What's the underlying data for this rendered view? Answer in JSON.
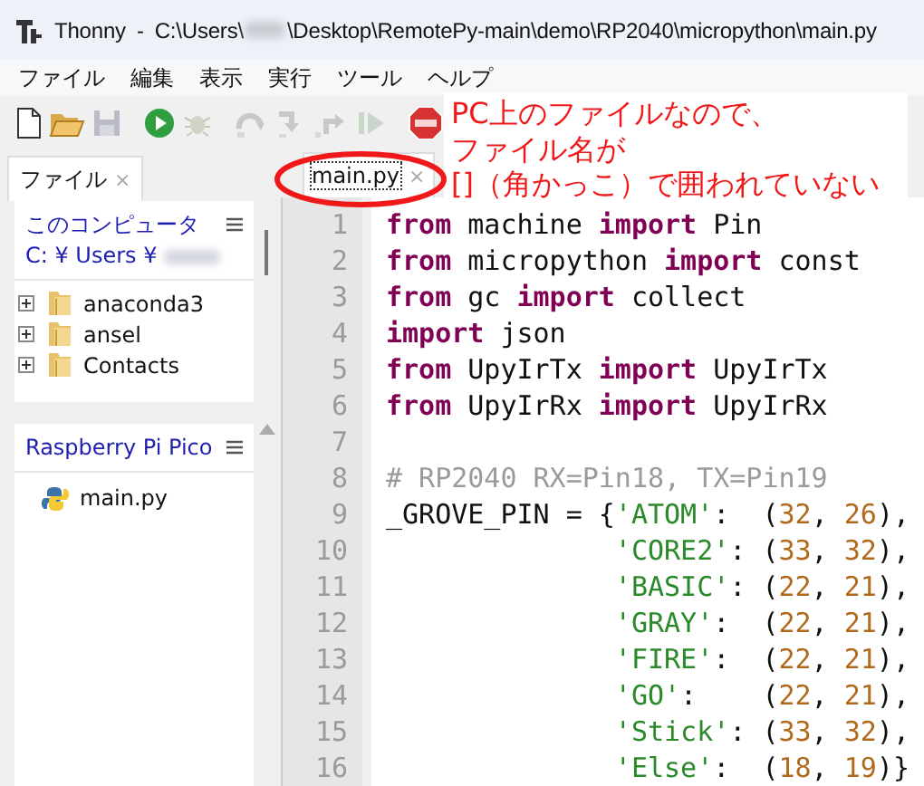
{
  "window": {
    "app": "Thonny",
    "separator": "-",
    "path_start": "C:\\Users\\",
    "path_end": "\\Desktop\\RemotePy-main\\demo\\RP2040\\micropython\\main.py"
  },
  "menu": [
    "ファイル",
    "編集",
    "表示",
    "実行",
    "ツール",
    "ヘルプ"
  ],
  "toolbar": [
    {
      "kind": "new",
      "disabled": false
    },
    {
      "kind": "open",
      "disabled": false
    },
    {
      "kind": "save",
      "disabled": true
    },
    {
      "kind": "run",
      "disabled": false
    },
    {
      "kind": "debug",
      "disabled": true
    },
    {
      "kind": "step_over",
      "disabled": true
    },
    {
      "kind": "step_into",
      "disabled": true
    },
    {
      "kind": "step_out",
      "disabled": true
    },
    {
      "kind": "resume",
      "disabled": true
    },
    {
      "kind": "stop",
      "disabled": false
    }
  ],
  "files_panel": {
    "tab": {
      "label": "ファイル",
      "close": "×",
      "selected": true
    },
    "sections": [
      {
        "title": "このコンピュータ",
        "path": "C: ¥ Users ¥",
        "items": [
          {
            "name": "anaconda3",
            "kind": "folder",
            "expanded": false
          },
          {
            "name": "ansel",
            "kind": "folder",
            "expanded": false
          },
          {
            "name": "Contacts",
            "kind": "folder",
            "expanded": false
          }
        ]
      },
      {
        "title": "Raspberry Pi Pico",
        "items": [
          {
            "name": "main.py",
            "kind": "python"
          }
        ]
      }
    ]
  },
  "editor": {
    "tabs": [
      {
        "label": "main.py",
        "close": "×",
        "selected": true
      }
    ],
    "lines": [
      {
        "number": "1",
        "tokens": [
          {
            "kind": "keyword",
            "text": "from"
          },
          {
            "kind": "plain",
            "text": " machine "
          },
          {
            "kind": "keyword",
            "text": "import"
          },
          {
            "kind": "plain",
            "text": " Pin"
          }
        ]
      },
      {
        "number": "2",
        "tokens": [
          {
            "kind": "keyword",
            "text": "from"
          },
          {
            "kind": "plain",
            "text": " micropython "
          },
          {
            "kind": "keyword",
            "text": "import"
          },
          {
            "kind": "plain",
            "text": " const"
          }
        ]
      },
      {
        "number": "3",
        "tokens": [
          {
            "kind": "keyword",
            "text": "from"
          },
          {
            "kind": "plain",
            "text": " gc "
          },
          {
            "kind": "keyword",
            "text": "import"
          },
          {
            "kind": "plain",
            "text": " collect"
          }
        ]
      },
      {
        "number": "4",
        "tokens": [
          {
            "kind": "keyword",
            "text": "import"
          },
          {
            "kind": "plain",
            "text": " json"
          }
        ]
      },
      {
        "number": "5",
        "tokens": [
          {
            "kind": "keyword",
            "text": "from"
          },
          {
            "kind": "plain",
            "text": " UpyIrTx "
          },
          {
            "kind": "keyword",
            "text": "import"
          },
          {
            "kind": "plain",
            "text": " UpyIrTx"
          }
        ]
      },
      {
        "number": "6",
        "tokens": [
          {
            "kind": "keyword",
            "text": "from"
          },
          {
            "kind": "plain",
            "text": " UpyIrRx "
          },
          {
            "kind": "keyword",
            "text": "import"
          },
          {
            "kind": "plain",
            "text": " UpyIrRx"
          }
        ]
      },
      {
        "number": "7"
      },
      {
        "number": "8",
        "tokens": [
          {
            "kind": "comment",
            "text": "# RP2040 RX=Pin18, TX=Pin19"
          }
        ]
      },
      {
        "number": "9",
        "tokens": [
          {
            "kind": "plain",
            "text": "_GROVE_PIN = {"
          },
          {
            "kind": "string",
            "text": "'ATOM'"
          },
          {
            "kind": "plain",
            "text": ":  ("
          },
          {
            "kind": "number",
            "text": "32"
          },
          {
            "kind": "plain",
            "text": ", "
          },
          {
            "kind": "number",
            "text": "26"
          },
          {
            "kind": "plain",
            "text": "),"
          }
        ]
      },
      {
        "number": "10",
        "kind": "continuation",
        "tokens": [
          {
            "kind": "string",
            "text": "'CORE2'"
          },
          {
            "kind": "plain",
            "text": ": ("
          },
          {
            "kind": "number",
            "text": "33"
          },
          {
            "kind": "plain",
            "text": ", "
          },
          {
            "kind": "number",
            "text": "32"
          },
          {
            "kind": "plain",
            "text": "),"
          }
        ]
      },
      {
        "number": "11",
        "kind": "continuation",
        "tokens": [
          {
            "kind": "string",
            "text": "'BASIC'"
          },
          {
            "kind": "plain",
            "text": ": ("
          },
          {
            "kind": "number",
            "text": "22"
          },
          {
            "kind": "plain",
            "text": ", "
          },
          {
            "kind": "number",
            "text": "21"
          },
          {
            "kind": "plain",
            "text": "),"
          }
        ]
      },
      {
        "number": "12",
        "kind": "continuation",
        "tokens": [
          {
            "kind": "string",
            "text": "'GRAY'"
          },
          {
            "kind": "plain",
            "text": ":  ("
          },
          {
            "kind": "number",
            "text": "22"
          },
          {
            "kind": "plain",
            "text": ", "
          },
          {
            "kind": "number",
            "text": "21"
          },
          {
            "kind": "plain",
            "text": "),"
          }
        ]
      },
      {
        "number": "13",
        "kind": "continuation",
        "tokens": [
          {
            "kind": "string",
            "text": "'FIRE'"
          },
          {
            "kind": "plain",
            "text": ":  ("
          },
          {
            "kind": "number",
            "text": "22"
          },
          {
            "kind": "plain",
            "text": ", "
          },
          {
            "kind": "number",
            "text": "21"
          },
          {
            "kind": "plain",
            "text": "),"
          }
        ]
      },
      {
        "number": "14",
        "kind": "continuation",
        "tokens": [
          {
            "kind": "string",
            "text": "'GO'"
          },
          {
            "kind": "plain",
            "text": ":    ("
          },
          {
            "kind": "number",
            "text": "22"
          },
          {
            "kind": "plain",
            "text": ", "
          },
          {
            "kind": "number",
            "text": "21"
          },
          {
            "kind": "plain",
            "text": "),"
          }
        ]
      },
      {
        "number": "15",
        "kind": "continuation",
        "tokens": [
          {
            "kind": "string",
            "text": "'Stick'"
          },
          {
            "kind": "plain",
            "text": ": ("
          },
          {
            "kind": "number",
            "text": "33"
          },
          {
            "kind": "plain",
            "text": ", "
          },
          {
            "kind": "number",
            "text": "32"
          },
          {
            "kind": "plain",
            "text": "),"
          }
        ]
      },
      {
        "number": "16",
        "kind": "continuation",
        "tokens": [
          {
            "kind": "string",
            "text": "'Else'"
          },
          {
            "kind": "plain",
            "text": ":  ("
          },
          {
            "kind": "number",
            "text": "18"
          },
          {
            "kind": "plain",
            "text": ", "
          },
          {
            "kind": "number",
            "text": "19"
          },
          {
            "kind": "plain",
            "text": ")}"
          }
        ]
      }
    ]
  },
  "annotation": {
    "lines": [
      "PC上のファイルなので、",
      "ファイル名が",
      "[]（角かっこ）で囲われていない"
    ]
  }
}
